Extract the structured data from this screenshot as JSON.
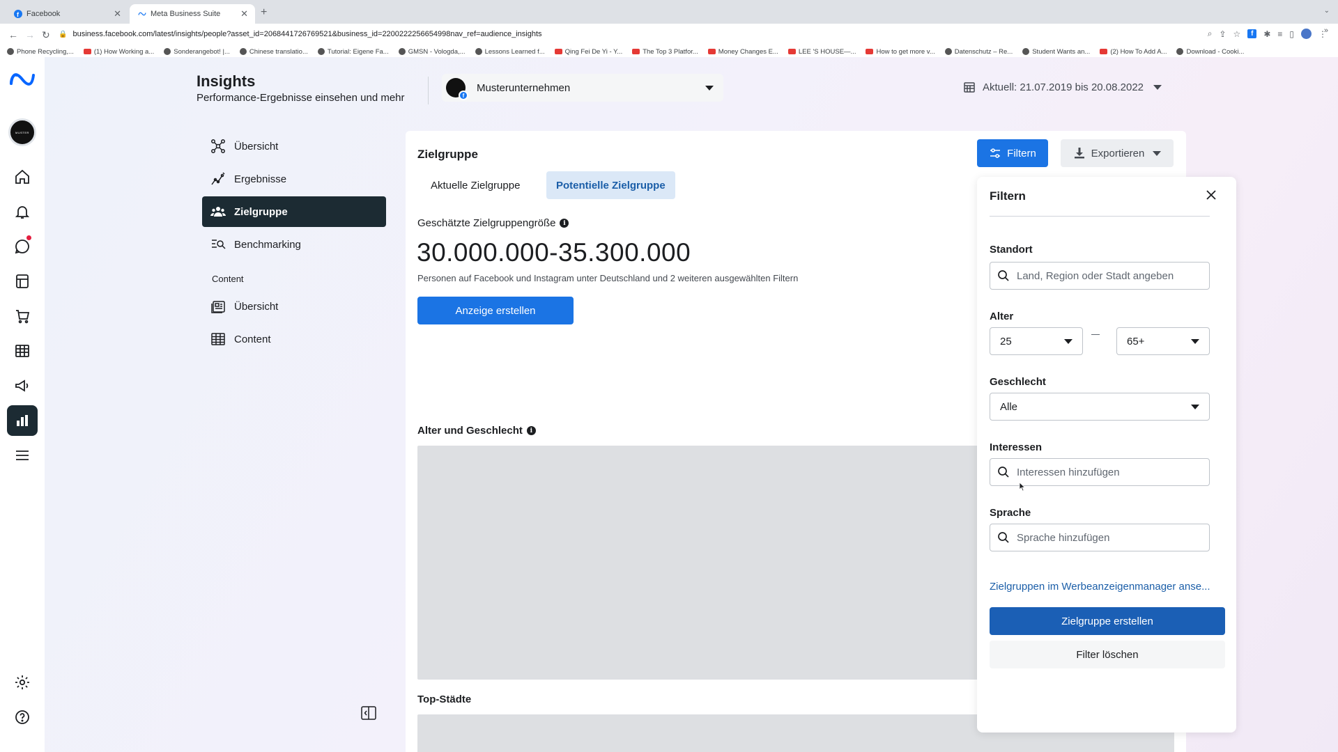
{
  "browser": {
    "tabs": [
      {
        "label": "Facebook",
        "active": false
      },
      {
        "label": "Meta Business Suite",
        "active": true
      }
    ],
    "url": "business.facebook.com/latest/insights/people?asset_id=2068441726769521&business_id=2200222256654998nav_ref=audience_insights",
    "bookmarks": [
      {
        "label": "Phone Recycling,...",
        "icon": "bookmark-icon"
      },
      {
        "label": "(1) How Working a...",
        "icon": "youtube-icon"
      },
      {
        "label": "Sonderangebot! |...",
        "icon": "bookmark-icon"
      },
      {
        "label": "Chinese translatio...",
        "icon": "bookmark-icon"
      },
      {
        "label": "Tutorial: Eigene Fa...",
        "icon": "hash-icon"
      },
      {
        "label": "GMSN - Vologda,...",
        "icon": "bookmark-icon"
      },
      {
        "label": "Lessons Learned f...",
        "icon": "bookmark-icon"
      },
      {
        "label": "Qing Fei De Yi - Y...",
        "icon": "youtube-icon"
      },
      {
        "label": "The Top 3 Platfor...",
        "icon": "youtube-icon"
      },
      {
        "label": "Money Changes E...",
        "icon": "youtube-icon"
      },
      {
        "label": "LEE 'S HOUSE—...",
        "icon": "airbnb-icon"
      },
      {
        "label": "How to get more v...",
        "icon": "youtube-icon"
      },
      {
        "label": "Datenschutz – Re...",
        "icon": "bookmark-icon"
      },
      {
        "label": "Student Wants an...",
        "icon": "bookmark-icon"
      },
      {
        "label": "(2) How To Add A...",
        "icon": "youtube-icon"
      },
      {
        "label": "Download - Cooki...",
        "icon": "bookmark-icon"
      }
    ]
  },
  "header": {
    "title": "Insights",
    "subtitle": "Performance-Ergebnisse einsehen und mehr",
    "account_name": "Musterunternehmen",
    "avatar_text": "MUSTER",
    "date_range": "Aktuell: 21.07.2019 bis 20.08.2022"
  },
  "sidebar": {
    "items": [
      {
        "label": "Übersicht",
        "icon": "overview-icon",
        "active": false
      },
      {
        "label": "Ergebnisse",
        "icon": "results-icon",
        "active": false
      },
      {
        "label": "Zielgruppe",
        "icon": "audience-icon",
        "active": true
      },
      {
        "label": "Benchmarking",
        "icon": "benchmarking-icon",
        "active": false
      }
    ],
    "section_label": "Content",
    "content_items": [
      {
        "label": "Übersicht",
        "icon": "content-overview-icon"
      },
      {
        "label": "Content",
        "icon": "table-icon"
      }
    ]
  },
  "main": {
    "title": "Zielgruppe",
    "filter_button": "Filtern",
    "export_button": "Exportieren",
    "tabs": [
      {
        "label": "Aktuelle Zielgruppe",
        "active": false
      },
      {
        "label": "Potentielle Zielgruppe",
        "active": true
      }
    ],
    "estimate_label": "Geschätzte Zielgruppengröße",
    "estimate_value": "30.000.000-35.300.000",
    "estimate_desc": "Personen auf Facebook und Instagram unter Deutschland und 2 weiteren ausgewählten Filtern",
    "create_ad_button": "Anzeige erstellen",
    "section_age_gender": "Alter und Geschlecht",
    "section_top_cities": "Top-Städte"
  },
  "filter_panel": {
    "title": "Filtern",
    "location_label": "Standort",
    "location_placeholder": "Land, Region oder Stadt angeben",
    "age_label": "Alter",
    "age_from": "25",
    "age_to": "65+",
    "gender_label": "Geschlecht",
    "gender_value": "Alle",
    "interests_label": "Interessen",
    "interests_placeholder": "Interessen hinzufügen",
    "language_label": "Sprache",
    "language_placeholder": "Sprache hinzufügen",
    "ads_manager_link": "Zielgruppen im Werbeanzeigenmanager anse...",
    "create_audience_button": "Zielgruppe erstellen",
    "clear_filters_button": "Filter löschen"
  },
  "colors": {
    "primary": "#1b74e4",
    "active_nav": "#1c2b33",
    "tab_active_bg": "#dbe8f7",
    "link": "#1b5ea8",
    "notification": "#e41e3f"
  }
}
